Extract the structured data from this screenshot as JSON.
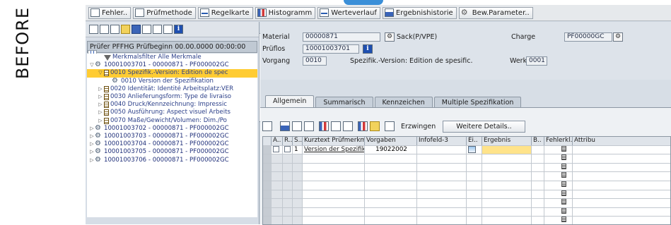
{
  "side_label": "BEFORE",
  "toolbar": {
    "buttons": [
      {
        "label": "Fehler..",
        "icon": "new-document-icon"
      },
      {
        "label": "Prüfmethode",
        "icon": "method-icon"
      },
      {
        "label": "Regelkarte",
        "icon": "control-chart-icon"
      },
      {
        "label": "Histogramm",
        "icon": "histogram-icon"
      },
      {
        "label": "Werteverlauf",
        "icon": "value-trend-icon"
      },
      {
        "label": "Ergebnishistorie",
        "icon": "result-history-icon"
      },
      {
        "label": "Bew.Parameter..",
        "icon": "valuation-parameter-icon"
      }
    ]
  },
  "left_panel": {
    "header": "Prüfer PFFHG Prüfbeginn 00.00.0000 00:00:00",
    "tree": [
      {
        "text": "Merkmalsfilter Alle Merkmale",
        "level": 1,
        "icon": "filter-icon",
        "caret": ""
      },
      {
        "text": "10001003701 - 00000871 - PF000002GC",
        "level": 0,
        "icon": "inspection-lot-icon",
        "caret": "▽"
      },
      {
        "text": "0010 Spezifik.-Version: Edition de spec",
        "level": 1,
        "icon": "operation-icon",
        "caret": "▽",
        "selected": true
      },
      {
        "text": "0010 Version der Spezifikation",
        "level": 2,
        "icon": "characteristic-icon",
        "caret": ""
      },
      {
        "text": "0020 Identität: Identité Arbeitsplatz:VER",
        "level": 1,
        "icon": "operation-icon",
        "caret": "▷"
      },
      {
        "text": "0030 Anlieferungsform: Type de livraiso",
        "level": 1,
        "icon": "operation-icon",
        "caret": "▷"
      },
      {
        "text": "0040 Druck/Kennzeichnung: Impressic",
        "level": 1,
        "icon": "operation-icon",
        "caret": "▷"
      },
      {
        "text": "0050 Ausführung: Aspect visuel Arbeits",
        "level": 1,
        "icon": "operation-icon",
        "caret": "▷"
      },
      {
        "text": "0070 Maße/Gewicht/Volumen: Dim./Po",
        "level": 1,
        "icon": "operation-icon",
        "caret": "▷"
      },
      {
        "text": "10001003702 - 00000871 - PF000002GC",
        "level": 0,
        "icon": "inspection-lot-icon",
        "caret": "▷"
      },
      {
        "text": "10001003703 - 00000871 - PF000002GC",
        "level": 0,
        "icon": "inspection-lot-icon",
        "caret": "▷"
      },
      {
        "text": "10001003704 - 00000871 - PF000002GC",
        "level": 0,
        "icon": "inspection-lot-icon",
        "caret": "▷"
      },
      {
        "text": "10001003705 - 00000871 - PF000002GC",
        "level": 0,
        "icon": "inspection-lot-icon",
        "caret": "▷"
      },
      {
        "text": "10001003706 - 00000871 - PF000002GC",
        "level": 0,
        "icon": "inspection-lot-icon",
        "caret": "▷"
      }
    ]
  },
  "header_form": {
    "material_label": "Material",
    "material_value": "00000871",
    "material_desc": "Sack(P/VPE)",
    "charge_label": "Charge",
    "charge_value": "PF00000GC",
    "pruflos_label": "Prüflos",
    "pruflos_value": "10001003701",
    "vorgang_label": "Vorgang",
    "vorgang_value": "0010",
    "vorgang_desc": "Spezifik.-Version: Edition de spesific.",
    "werk_label": "Werk",
    "werk_value": "0001"
  },
  "tabs": [
    {
      "label": "Allgemein",
      "active": true
    },
    {
      "label": "Summarisch",
      "active": false
    },
    {
      "label": "Kennzeichen",
      "active": false
    },
    {
      "label": "Multiple Spezifikation",
      "active": false
    }
  ],
  "grid_toolbar": {
    "erzwingen_label": "Erzwingen",
    "details_label": "Weitere Details.."
  },
  "grid": {
    "columns": [
      "A..",
      "R..",
      "S..",
      "Kurztext Prüfmerkmal",
      "Vorgaben",
      "Infofeld-3",
      "Ei..",
      "Ergebnis",
      "B..",
      "Fehlerkl..",
      "Attribu"
    ],
    "rows": [
      {
        "s": "1",
        "kurztext": "Version der Spezifika.",
        "vorgaben": "19022002",
        "infofeld": "",
        "ergebnis": ""
      }
    ]
  }
}
